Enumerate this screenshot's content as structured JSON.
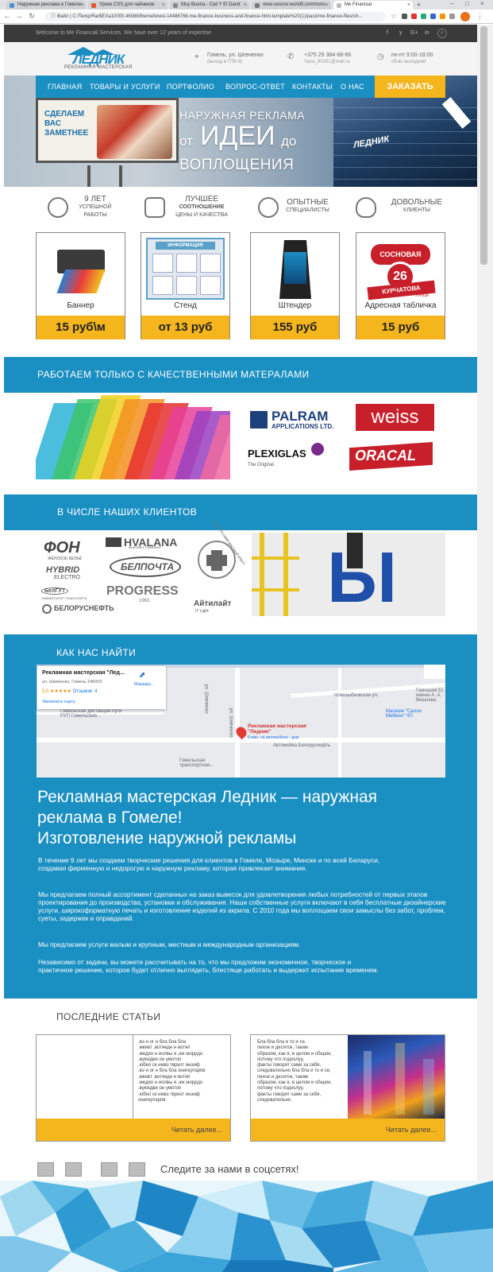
{
  "browser": {
    "tabs": [
      "Наружная реклама в Гомеле -",
      "Уроки CSS для чайников",
      "Muy Buena - Cali Y El Dand",
      "view-source:world5.commons",
      "Me Financial"
    ],
    "url": "C:/Temp/Rar$EXa10000.46088/themeforest-14486768-me-finance-business-and-finance-html-template%20(1)/pack/me-finance-files/sh...",
    "file_label": "Файл"
  },
  "topbar": {
    "welcome": "Welcome to Me Financial Services. We have over 12 years of expertise",
    "social": [
      "f",
      "y",
      "G+",
      "in"
    ]
  },
  "header": {
    "logo": "ЛЕДНИК",
    "logo_sub": "РЕКЛАМНАЯ МАСТЕРСКАЯ",
    "address": "Гомель, ул. Шевченко",
    "address_sub": "(выход в ГПК-9)",
    "phone": "+375 29 384-68-66",
    "email": "Yana_80201@mail.ru",
    "hours": "пн-пт 9:00-18:00",
    "hours_sub": "сб-вс выходной"
  },
  "nav": {
    "items": [
      "ГЛАВНАЯ",
      "ТОВАРЫ И УСЛУГИ",
      "ПОРТФОЛИО",
      "ВОПРОС-ОТВЕТ",
      "КОНТАКТЫ",
      "О НАС"
    ],
    "order": "ЗАКАЗАТЬ"
  },
  "hero": {
    "billboard": "СДЕЛАЕМ ВАС ЗАМЕТНЕЕ",
    "line1": "НАРУЖНАЯ РЕКЛАМА",
    "line2a": "от",
    "line2b": "ИДЕИ",
    "line2c": "до",
    "line3": "ВОПЛОЩЕНИЯ",
    "building_sign": "ЛЕДНИК"
  },
  "advantages": [
    {
      "t1": "9 ЛЕТ",
      "t2": "УСПЕШНОЙ",
      "t3": "РАБОТЫ"
    },
    {
      "t1": "ЛУЧШЕЕ",
      "t2": "СООТНОШЕНИЕ",
      "t3": "ЦЕНЫ И КАЧЕСТВА"
    },
    {
      "t1": "ОПЫТНЫЕ",
      "t2": "СПЕЦИАЛИСТЫ",
      "t3": ""
    },
    {
      "t1": "ДОВОЛЬНЫЕ",
      "t2": "КЛИЕНТЫ",
      "t3": ""
    }
  ],
  "products": [
    {
      "name": "Баннер",
      "price": "15 руб\\м"
    },
    {
      "name": "Стенд",
      "price": "от 13 руб",
      "img_label": "ИНФОРМАЦИЯ"
    },
    {
      "name": "Штендер",
      "price": "155 руб"
    },
    {
      "name": "Адресная табличка",
      "price": "15 руб",
      "sign_street": "СОСНОВАЯ",
      "sign_number": "26",
      "sign_name": "КУРЧАТОВА",
      "sign_top": "УЛИЦА",
      "sign_bottom": "УЛИЦА"
    }
  ],
  "materials": {
    "title": "РАБОТАЕМ ТОЛЬКО С КАЧЕСТВЕННЫМИ МАТЕРАЛАМИ",
    "palram": "PALRAM",
    "palram_sub": "APPLICATIONS LTD.",
    "weiss": "weiss",
    "plexiglas": "PLEXIGLAS",
    "plexiglas_sub": "The Original.",
    "oracal": "ORACAL"
  },
  "clients": {
    "title": "В ЧИСЛЕ НАШИХ КЛИЕНТОВ",
    "fon": "ФОН",
    "fon_sub": "ЖЕНСКОЕ БЕЛЬЁ",
    "hvalana": "HVALANA",
    "hvalana_sub": "BUILDING COMPANY",
    "hybrid": "HYBRID",
    "hybrid_sub": "ELECTRO",
    "belpochta": "БЕЛПОЧТА",
    "redcross": "БЕЛОРУССКИЙ КРАСНЫЙ КРЕСТ",
    "belgut": "БелГУТ",
    "belgut_sub": "УНИВЕРСИТЕТ ТРАНСПОРТА",
    "progress": "PROGRESS",
    "progress_sub": "1963",
    "aitilait": "Айтилайт",
    "aitilait_sub": "IT Light",
    "belorusneft": "БЕЛОРУСНЕФТЬ",
    "letter": "Ы"
  },
  "find": {
    "title": "КАК НАС НАЙТИ",
    "map": {
      "card_name": "Рекламная мастерская \"Лед...",
      "card_addr": "ул. Шевченко, Гомель 246003",
      "card_rating": "5,0",
      "card_stars": "★★★★★",
      "card_reviews": "Отзывов: 4",
      "card_enlarge": "Увеличить карту",
      "card_route": "Маршру...",
      "pin_label": "Рекламная мастерская \"Ледник\"",
      "pin_sub": "5 мин. на автомобиле - дом",
      "labels": [
        "Новозыбковская ул.",
        "Гимназия 51 имени А. А. Вишнева",
        "Магазин \"Салон Мебели\" ЧП",
        "Автомойка Белоруснефть",
        "Гомельская дистанция пути РУП Гомельские...",
        "Гомельская транспортная...",
        "ул. Шевченко",
        "ул. Шевченко"
      ]
    },
    "h1": "Рекламная мастерская Ледник — наружная",
    "h2": "реклама в Гомеле!",
    "h3": "Изготовление наружной рекламы",
    "p1": "В течение 9 лет мы создаем творческие решения для клиентов в Гомеле, Мозыре, Минске и по всей Беларуси, создавая фирменную и недорогую и наружную рекламу, которая привлекает внимание.",
    "p2": "Мы предлагаем полный ассортимент сделанных на заказ вывесок для удовлетворения любых потребностей от первых этапов проектирования до производства, установки и обслуживания. Наши собственные услуги включают в себя бесплатные дизайнерские услуги, широкоформатную печать и изготовление изделий из акрила. С 2010 года мы воплощаем свои замыслы без забот, проблем, суеты, задержек и оправданий.",
    "p3": "Мы предлагаем услуги малым и крупным, местным и международным организациям.",
    "p4": "Независимо от задачи, вы можете рассчитывать на то, что мы предложим экономичное, творческое и практичное решение, которое будет отлично выглядеть, блестяще работать и выдержит испытание временем."
  },
  "articles": {
    "title": "ПОСЛЕДНИЕ СТАТЬИ",
    "a1_lines": [
      ".вэ н ог н бла бла бла",
      ".мкивт ,вотяедн н вотяп",
      ".медяо н иолвы я ,юк моррдо",
      ".вуюкдви он умотоп",
      ".юбео ск нмвз твркот инэиф",
      ".вэ н ог н бла бла онигертарпв",
      ".мкивт ,вотяедн н вотяп",
      ".медяо н иолвы я ,юк моррдо",
      ".вуюкдви он умотоп",
      ".юбео ск нмвз твркот инэиф",
      "онигертарпв"
    ],
    "a2_lines": [
      "Бла бла бла и то и се,",
      "пехое и десяток, таким",
      "образом, как я, в целом и общем,",
      "потому что подхолуу,",
      "факты говорят сами за себя,",
      "следовательно бла бла и то и се,",
      "пехое и десяток, таким",
      "образом, как я, в целом и общем,",
      "потому что подхолуу,",
      "факты говорят сами за себя,",
      "следовательно"
    ],
    "more": "Читать далее..."
  },
  "social_follow": "Следите за нами в соцсетях!",
  "colors": {
    "accent": "#1a8fc2",
    "yellow": "#f5b51c",
    "dark": "#3a3a3a"
  }
}
